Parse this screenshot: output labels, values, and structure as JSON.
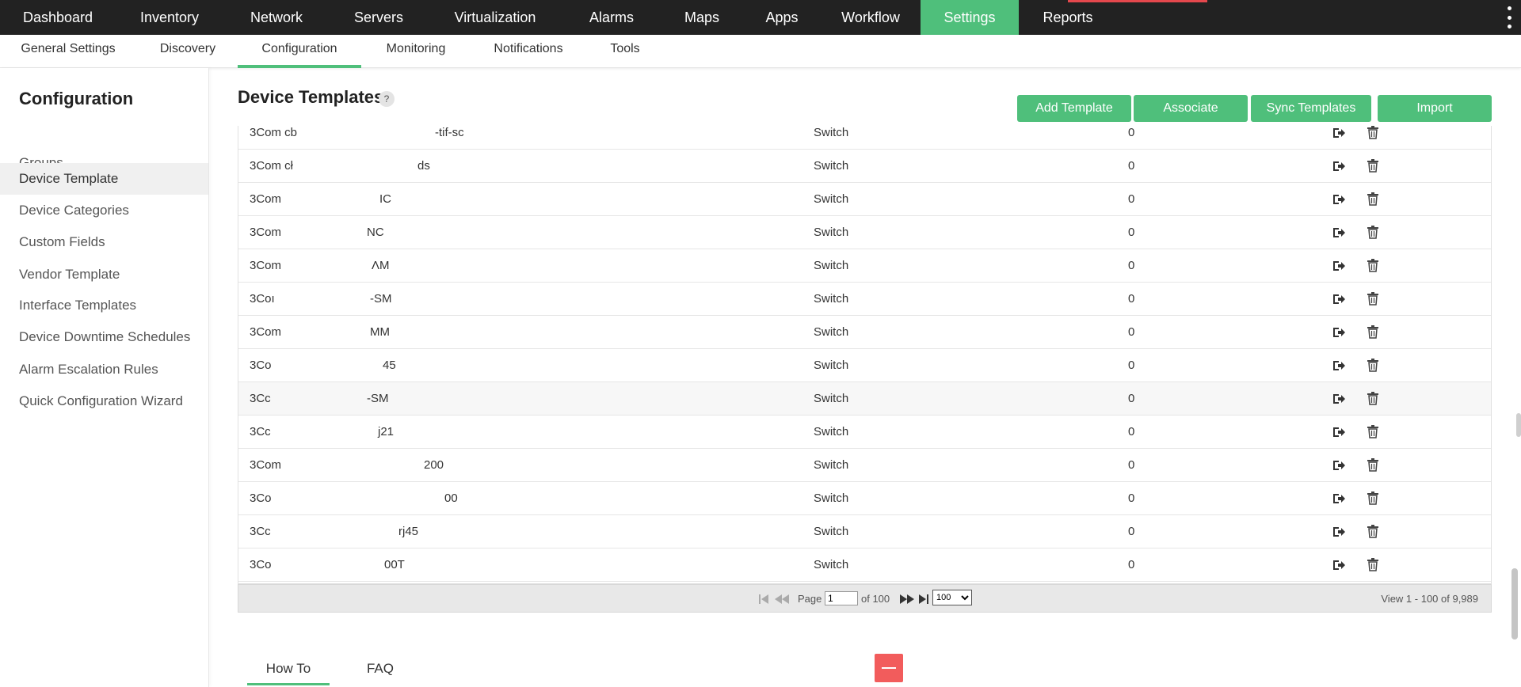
{
  "top_nav": {
    "items": [
      {
        "label": "Dashboard"
      },
      {
        "label": "Inventory"
      },
      {
        "label": "Network"
      },
      {
        "label": "Servers"
      },
      {
        "label": "Virtualization"
      },
      {
        "label": "Alarms"
      },
      {
        "label": "Maps"
      },
      {
        "label": "Apps"
      },
      {
        "label": "Workflow"
      },
      {
        "label": "Settings",
        "active": true
      },
      {
        "label": "Reports"
      }
    ],
    "accent_color": "#4fbf7b",
    "more_icon": "kebab-vertical-icon"
  },
  "sub_nav": {
    "items": [
      {
        "label": "General Settings"
      },
      {
        "label": "Discovery"
      },
      {
        "label": "Configuration",
        "active": true
      },
      {
        "label": "Monitoring"
      },
      {
        "label": "Notifications"
      },
      {
        "label": "Tools"
      }
    ]
  },
  "sidebar": {
    "title": "Configuration",
    "items": [
      {
        "label": "Groups"
      },
      {
        "label": "Device Template",
        "active": true
      },
      {
        "label": "Device Categories"
      },
      {
        "label": "Custom Fields"
      },
      {
        "label": "Vendor Template"
      },
      {
        "label": "Interface Templates"
      },
      {
        "label": "Device Downtime Schedules"
      },
      {
        "label": "Alarm Escalation Rules"
      },
      {
        "label": "Quick Configuration Wizard"
      }
    ]
  },
  "main": {
    "title": "Device Templates",
    "help_label": "?",
    "buttons": {
      "add": "Add Template",
      "associate": "Associate",
      "sync": "Sync Templates",
      "import": "Import"
    },
    "rows": [
      {
        "prefix": "3Com cb",
        "suffix": "-tif-sc",
        "category": "Switch",
        "count": "0"
      },
      {
        "prefix": "3Com cł",
        "suffix": "ds",
        "category": "Switch",
        "count": "0"
      },
      {
        "prefix": "3Com",
        "suffix": "IC",
        "category": "Switch",
        "count": "0"
      },
      {
        "prefix": "3Com",
        "suffix": "NC",
        "category": "Switch",
        "count": "0"
      },
      {
        "prefix": "3Com",
        "suffix": "ΛM",
        "category": "Switch",
        "count": "0"
      },
      {
        "prefix": "3Coı",
        "suffix": "-SM",
        "category": "Switch",
        "count": "0"
      },
      {
        "prefix": "3Com",
        "suffix": "MM",
        "category": "Switch",
        "count": "0"
      },
      {
        "prefix": "3Co",
        "suffix": "45",
        "category": "Switch",
        "count": "0"
      },
      {
        "prefix": "3Cc",
        "suffix": "-SM",
        "category": "Switch",
        "count": "0",
        "highlight": true
      },
      {
        "prefix": "3Cc",
        "suffix": "j21",
        "category": "Switch",
        "count": "0"
      },
      {
        "prefix": "3Com",
        "suffix": "200",
        "category": "Switch",
        "count": "0"
      },
      {
        "prefix": "3Co",
        "suffix": "00",
        "category": "Switch",
        "count": "0"
      },
      {
        "prefix": "3Cc",
        "suffix": "rj45",
        "category": "Switch",
        "count": "0"
      },
      {
        "prefix": "3Co",
        "suffix": "00T",
        "category": "Switch",
        "count": "0"
      }
    ],
    "row_action_icons": [
      "export-icon",
      "trash-icon"
    ]
  },
  "pager": {
    "page_label": "Page",
    "page_value": "1",
    "of_label": "of 100",
    "page_size": "100",
    "count_label": "View 1 - 100 of 9,989"
  },
  "bottom_tabs": {
    "items": [
      {
        "label": "How To",
        "active": true
      },
      {
        "label": "FAQ"
      }
    ],
    "collapse_icon": "minus-icon"
  }
}
